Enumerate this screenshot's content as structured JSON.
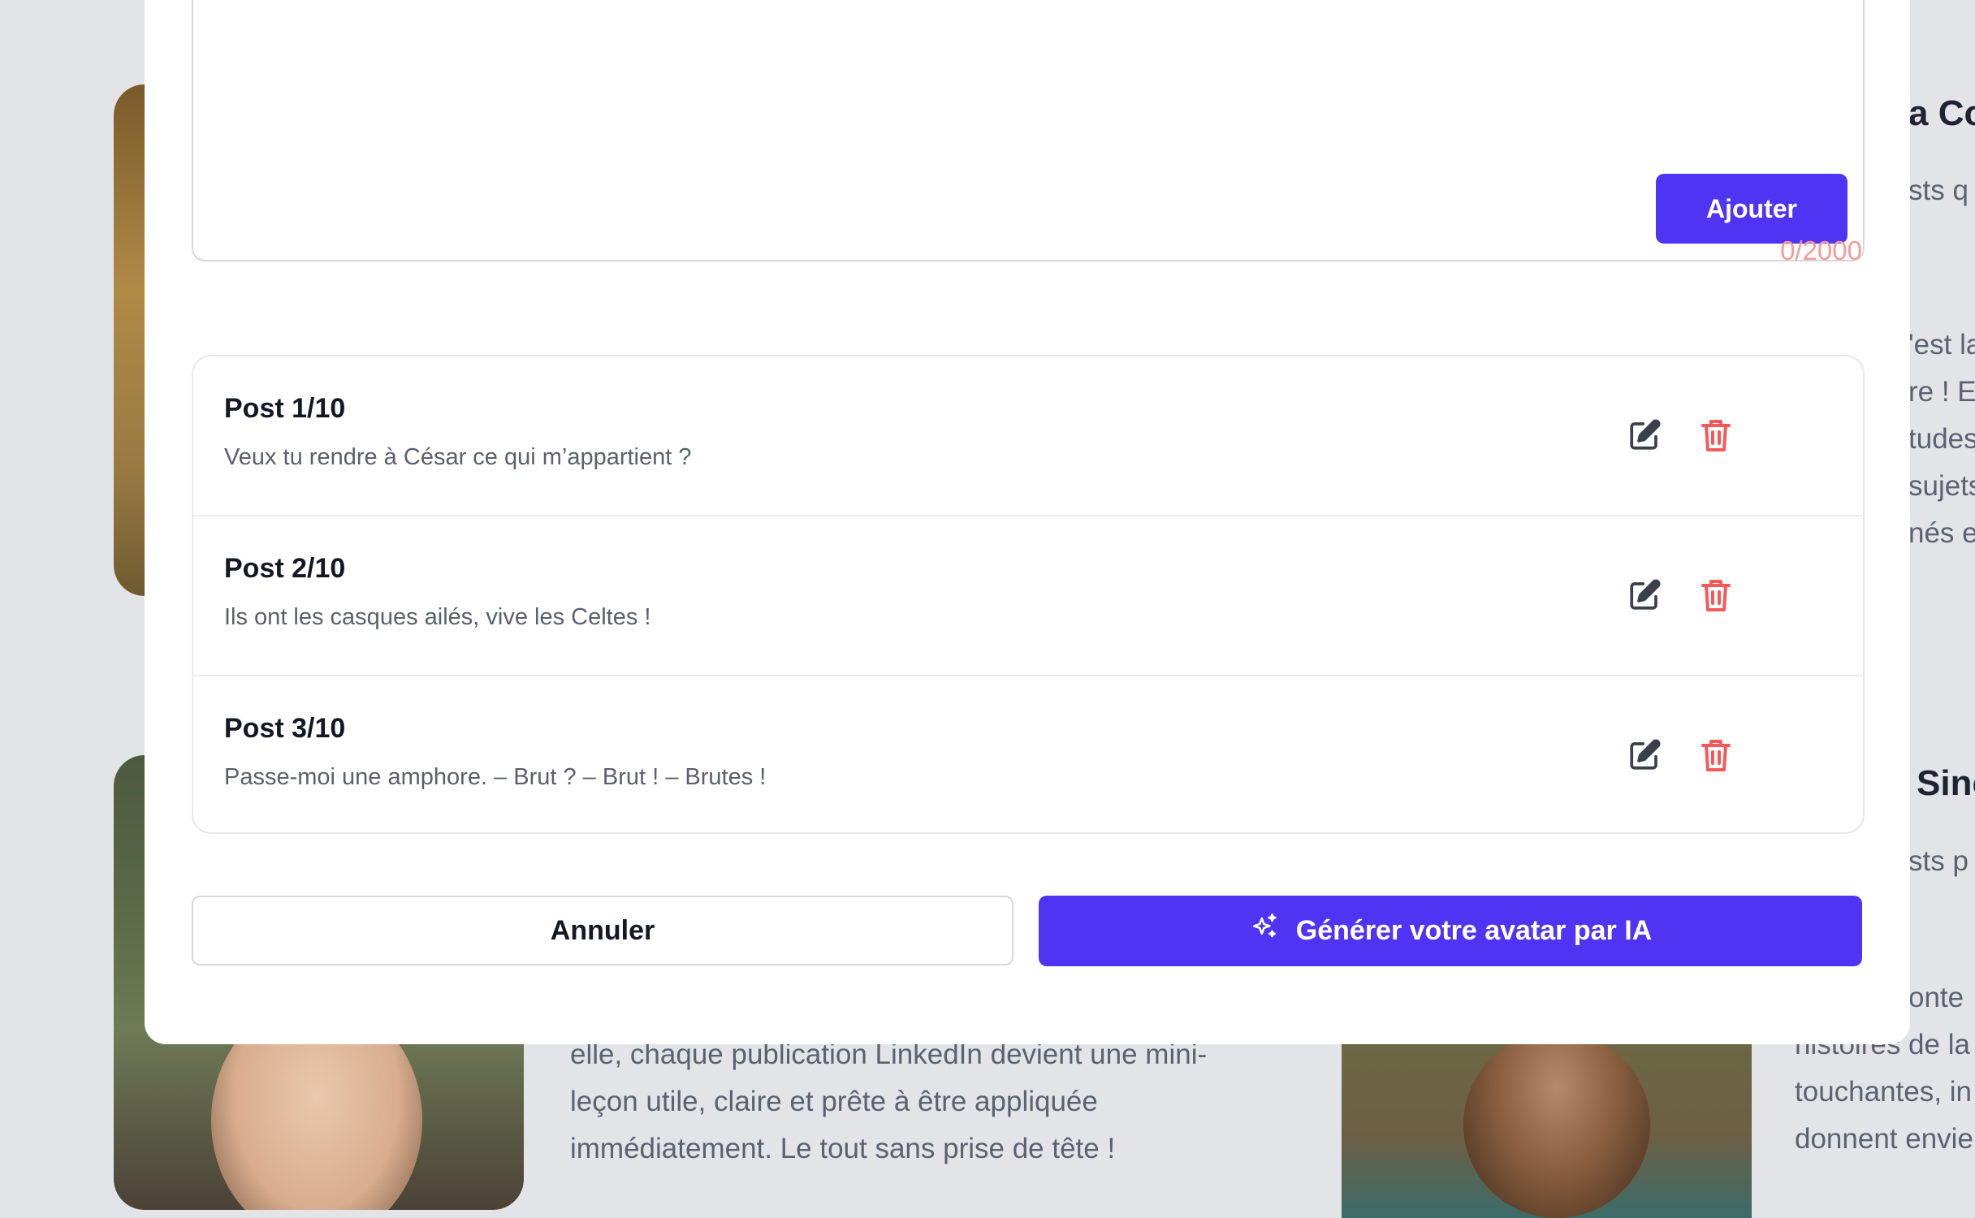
{
  "background": {
    "right_column_headings": [
      "a Co",
      "Sinc"
    ],
    "right_column_lines_top": [
      "sts q",
      "'est la",
      "re ! E",
      "tudes",
      "sujets",
      "nés et"
    ],
    "right_column_lines_mid": [
      "sts p"
    ],
    "right_column_lines_bottom": [
      "onte",
      "histoires de la",
      "touchantes, in",
      "donnent envie"
    ],
    "paragraph_lines": [
      "elle, chaque publication LinkedIn devient une mini-",
      "leçon utile, claire et prête à être appliquée",
      "immédiatement. Le tout sans prise de tête !"
    ]
  },
  "modal": {
    "add_button_label": "Ajouter",
    "char_counter": "0/2000",
    "posts": [
      {
        "title": "Post 1/10",
        "text": "Veux tu rendre à César ce qui m’appartient ?"
      },
      {
        "title": "Post 2/10",
        "text": "Ils ont les casques ailés, vive les Celtes !"
      },
      {
        "title": "Post 3/10",
        "text": "Passe-moi une amphore. – Brut ? – Brut ! – Brutes !"
      }
    ],
    "cancel_label": "Annuler",
    "generate_label": "Générer votre avatar par IA",
    "colors": {
      "primary": "#4f35f3",
      "danger": "#f25a5a",
      "counter": "#f59a9a"
    }
  }
}
